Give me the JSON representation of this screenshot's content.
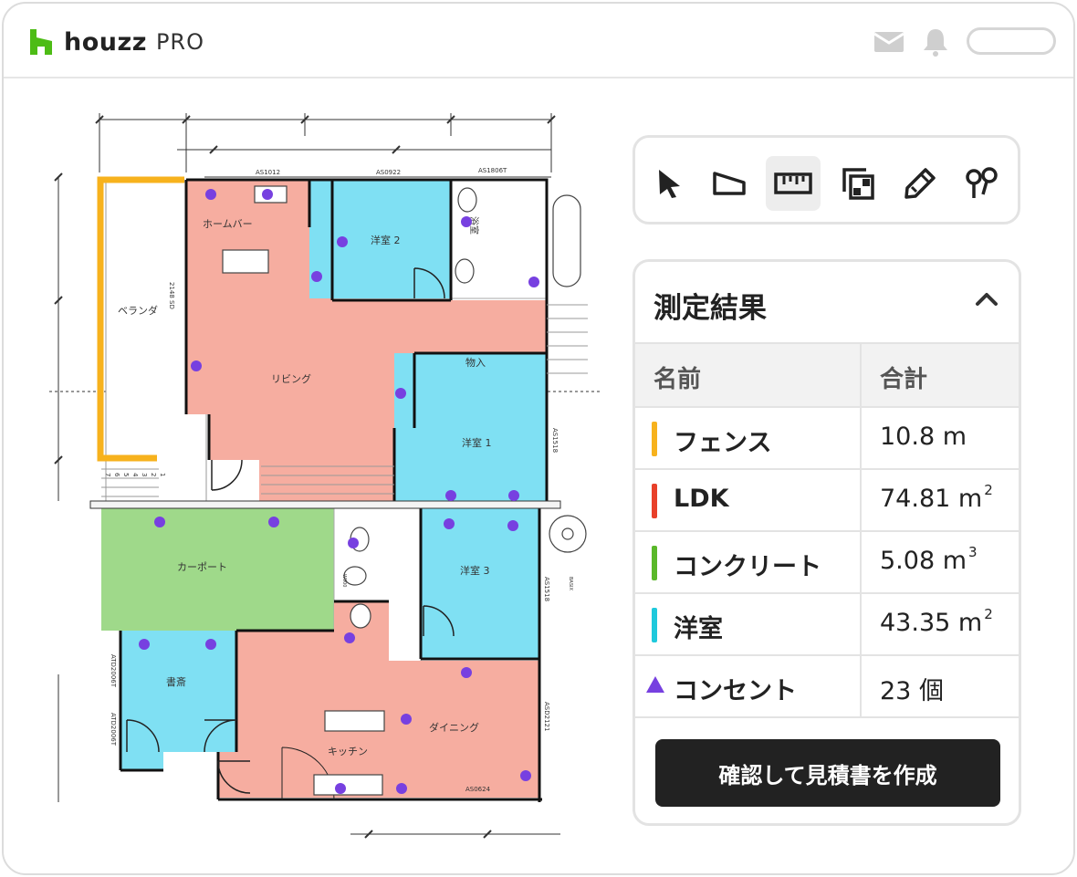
{
  "brand": {
    "name": "houzz",
    "suffix": "PRO",
    "color": "#4dbc15"
  },
  "header_icons": [
    "mail-icon",
    "bell-icon"
  ],
  "tools": [
    {
      "name": "select-tool",
      "icon": "cursor-arrow-icon",
      "active": false
    },
    {
      "name": "area-tool",
      "icon": "polygon-icon",
      "active": false
    },
    {
      "name": "measure-tool",
      "icon": "ruler-icon",
      "active": true
    },
    {
      "name": "rooms-tool",
      "icon": "overlapping-squares-icon",
      "active": false
    },
    {
      "name": "draw-tool",
      "icon": "pen-icon",
      "active": false
    },
    {
      "name": "count-tool",
      "icon": "pins-icon",
      "active": false
    }
  ],
  "panel": {
    "title": "測定結果",
    "col_name": "名前",
    "col_total": "合計",
    "rows": [
      {
        "name": "フェンス",
        "value": "10.8 m",
        "unit_sup": "",
        "color": "#f7b21d",
        "marker": "bar"
      },
      {
        "name": "LDK",
        "value": "74.81 m",
        "unit_sup": "2",
        "color": "#e8402a",
        "marker": "bar"
      },
      {
        "name": "コンクリート",
        "value": "5.08 m",
        "unit_sup": "3",
        "color": "#5ab82a",
        "marker": "bar"
      },
      {
        "name": "洋室",
        "value": "43.35 m",
        "unit_sup": "2",
        "color": "#1fc9dc",
        "marker": "bar"
      },
      {
        "name": "コンセント",
        "value": "23 個",
        "unit_sup": "",
        "color": "#7740e0",
        "marker": "triangle"
      }
    ],
    "cta": "確認して見積書を作成"
  },
  "plan": {
    "rooms": {
      "home_bar": "ホームバー",
      "veranda": "ベランダ",
      "living": "リビング",
      "storage": "物入",
      "western_2": "洋室 2",
      "western_1": "洋室 1",
      "western_3": "洋室 3",
      "carport": "カーポート",
      "study": "書斎",
      "dining": "ダイニング",
      "kitchen": "キッチン",
      "bath": "浴室"
    },
    "labels": {
      "as1012": "AS1012",
      "as0922": "AS0922",
      "as1806t": "AS1806T",
      "sd2148": "2148 SD",
      "as1518a": "AS1518",
      "as1518b": "AS1518",
      "basix": "BASIX",
      "atd2006a": "ATD2006T",
      "atd2006b": "ATD2006T",
      "asd2121": "ASD2121",
      "as0624": "AS0624",
      "w900": "W900",
      "stair_steps": [
        "1",
        "2",
        "3",
        "4",
        "5",
        "6",
        "7"
      ]
    },
    "colors": {
      "ldk": "#f6ada0",
      "western": "#7fe0f3",
      "concrete": "#9fd98a",
      "fence": "#f7b21d",
      "outlet": "#7740e0"
    }
  }
}
